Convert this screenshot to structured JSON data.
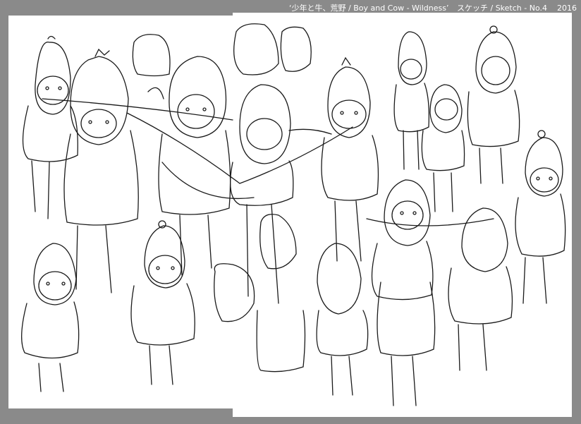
{
  "caption": {
    "title": "‘少年と牛、荒野 / Boy and Cow - Wildness’",
    "sketch": "スケッチ / Sketch - No.4",
    "year": "2016"
  },
  "colors": {
    "background": "#8a8a8a",
    "paper": "#ffffff",
    "ink": "#1a1a1a"
  }
}
